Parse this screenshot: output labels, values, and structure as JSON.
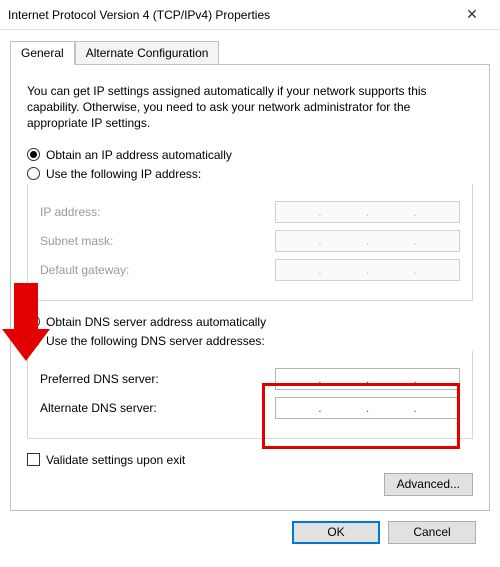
{
  "window": {
    "title": "Internet Protocol Version 4 (TCP/IPv4) Properties",
    "close_glyph": "✕"
  },
  "tabs": {
    "general": "General",
    "alternate": "Alternate Configuration"
  },
  "intro": "You can get IP settings assigned automatically if your network supports this capability. Otherwise, you need to ask your network administrator for the appropriate IP settings.",
  "ip": {
    "auto": "Obtain an IP address automatically",
    "manual": "Use the following IP address:",
    "ip_label": "IP address:",
    "subnet_label": "Subnet mask:",
    "gateway_label": "Default gateway:"
  },
  "dns": {
    "auto": "Obtain DNS server address automatically",
    "manual": "Use the following DNS server addresses:",
    "preferred_label": "Preferred DNS server:",
    "alternate_label": "Alternate DNS server:"
  },
  "validate": "Validate settings upon exit",
  "buttons": {
    "advanced": "Advanced...",
    "ok": "OK",
    "cancel": "Cancel"
  },
  "annotation": {
    "arrow_color": "#e20000",
    "red_box_color": "#e20000"
  }
}
